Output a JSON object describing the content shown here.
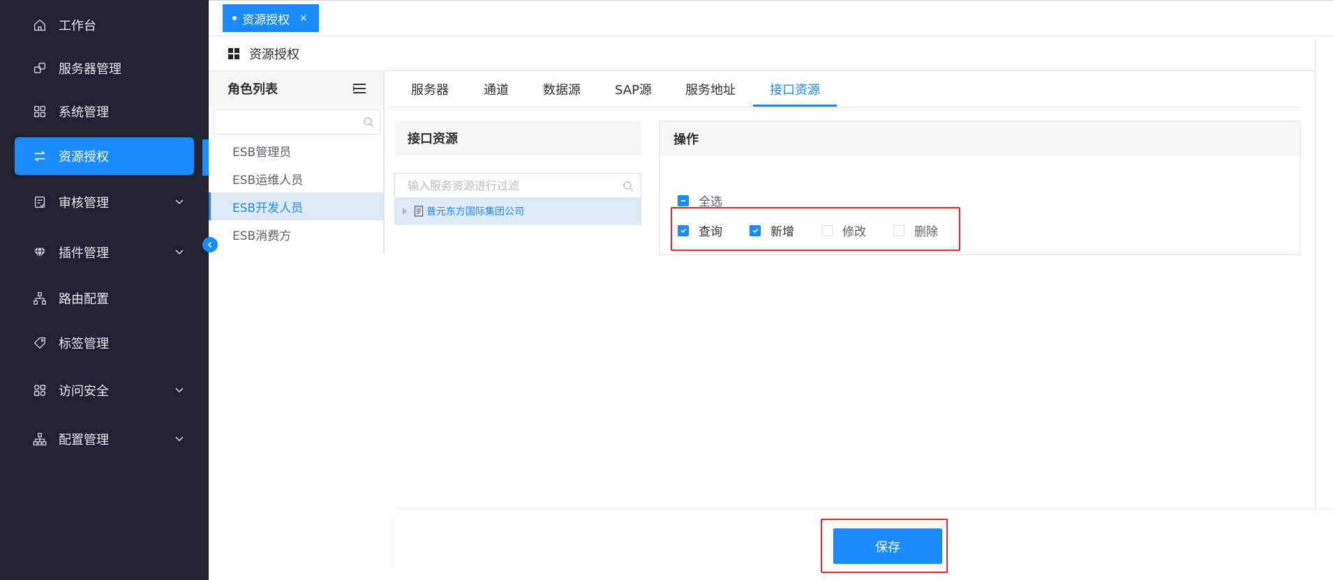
{
  "sidebar": {
    "items": [
      {
        "label": "工作台",
        "icon": "home-icon",
        "expandable": false,
        "active": false
      },
      {
        "label": "服务器管理",
        "icon": "server-manage-icon",
        "expandable": false,
        "active": false
      },
      {
        "label": "系统管理",
        "icon": "grid-apps-icon",
        "expandable": false,
        "active": false
      },
      {
        "label": "资源授权",
        "icon": "swap-arrows-icon",
        "expandable": false,
        "active": true
      },
      {
        "label": "审核管理",
        "icon": "audit-doc-icon",
        "expandable": true,
        "active": false
      },
      {
        "label": "插件管理",
        "icon": "diamond-icon",
        "expandable": true,
        "active": false
      },
      {
        "label": "路由配置",
        "icon": "route-tree-icon",
        "expandable": false,
        "active": false
      },
      {
        "label": "标签管理",
        "icon": "tag-icon",
        "expandable": false,
        "active": false
      },
      {
        "label": "访问安全",
        "icon": "security-icon",
        "expandable": true,
        "active": false
      },
      {
        "label": "配置管理",
        "icon": "org-chart-icon",
        "expandable": true,
        "active": false
      }
    ]
  },
  "top_tab": {
    "label": "资源授权",
    "close": "×"
  },
  "page": {
    "title": "资源授权"
  },
  "roles": {
    "title": "角色列表",
    "search_placeholder": "",
    "items": [
      "ESB管理员",
      "ESB运维人员",
      "ESB开发人员",
      "ESB消费方"
    ],
    "selected": "ESB开发人员"
  },
  "resource_tabs": {
    "items": [
      "服务器",
      "通道",
      "数据源",
      "SAP源",
      "服务地址",
      "接口资源"
    ],
    "active": "接口资源"
  },
  "interface_panel": {
    "title": "接口资源",
    "search_placeholder": "输入服务资源进行过滤",
    "tree_node": "普元东方国际集团公司"
  },
  "operations": {
    "title": "操作",
    "select_all": {
      "label": "全选",
      "state": "indeterminate"
    },
    "items": [
      {
        "label": "查询",
        "checked": true
      },
      {
        "label": "新增",
        "checked": true
      },
      {
        "label": "修改",
        "checked": false
      },
      {
        "label": "删除",
        "checked": false
      }
    ]
  },
  "footer": {
    "save_label": "保存"
  },
  "colors": {
    "sidebar_bg": "#1f2330",
    "accent": "#1a8cff",
    "highlight_border": "#e5262b",
    "selected_bg": "#dfe9f5"
  }
}
